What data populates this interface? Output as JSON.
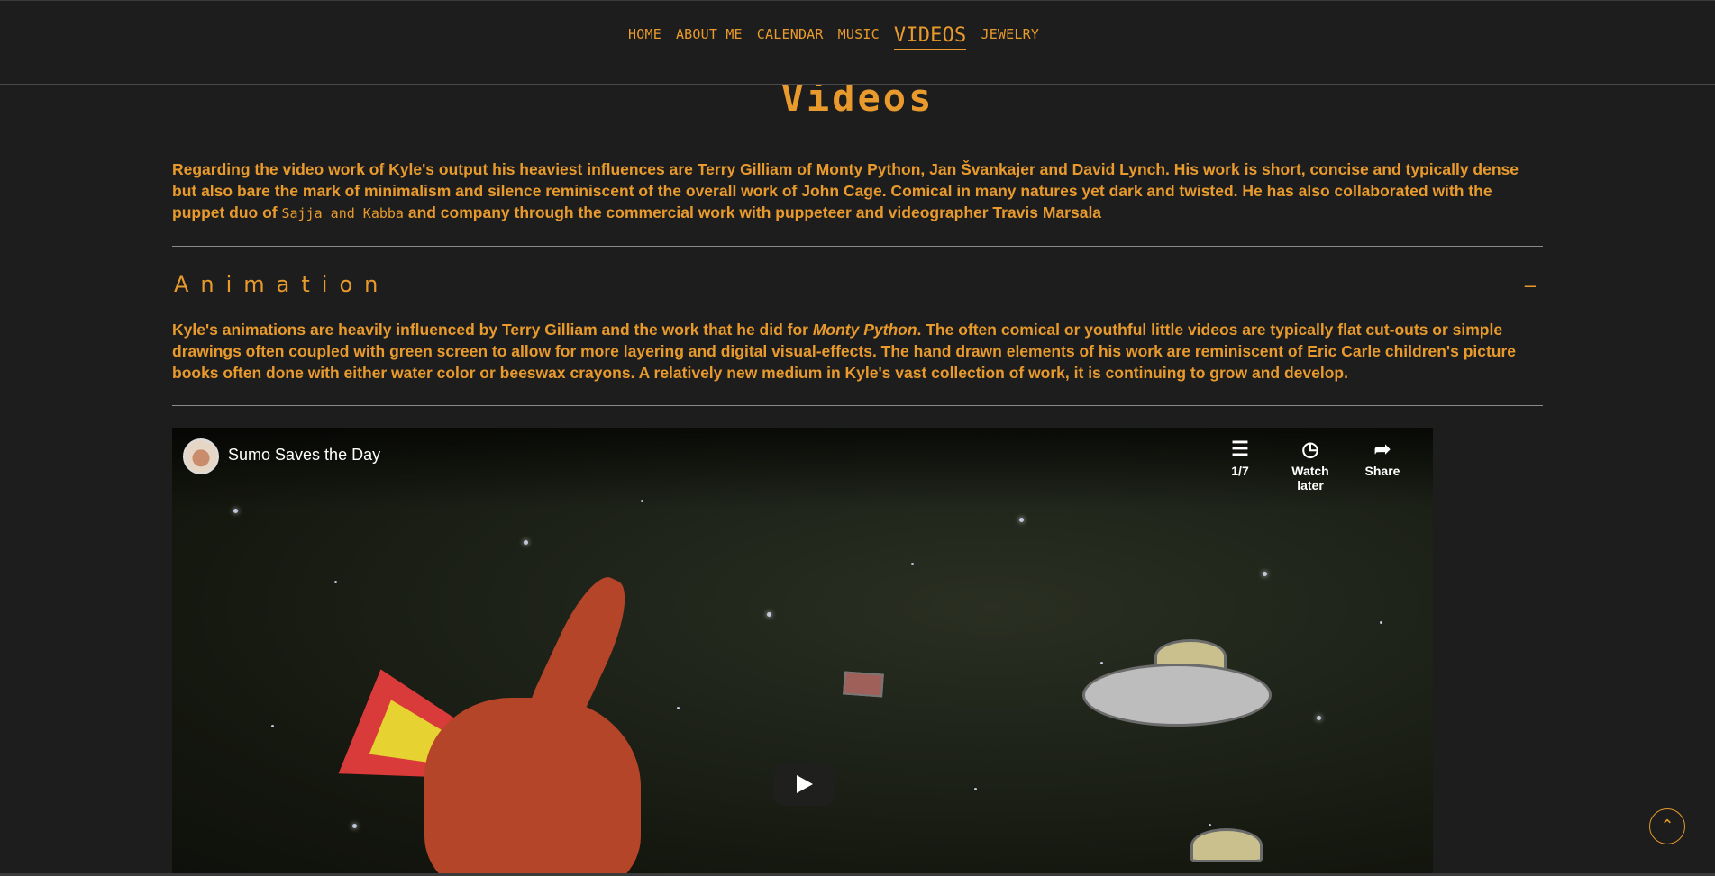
{
  "nav": {
    "items": [
      {
        "label": "HOME"
      },
      {
        "label": "ABOUT ME"
      },
      {
        "label": "CALENDAR"
      },
      {
        "label": "MUSIC"
      },
      {
        "label": "VIDEOS"
      },
      {
        "label": "JEWELRY"
      }
    ],
    "active": "VIDEOS"
  },
  "page": {
    "title": "Videos",
    "intro_1": "Regarding the video work of Kyle's output his heaviest influences are Terry Gilliam of Monty Python, Jan Švankajer and David Lynch. His work is short, concise and typically dense but also bare the mark of minimalism and silence reminiscent of the overall work of John Cage. Comical in many natures yet dark and twisted. He has also collaborated with the puppet duo of ",
    "intro_link": "Sajja and Kabba",
    "intro_2": " and company through the commercial work with puppeteer and videographer Travis Marsala"
  },
  "section": {
    "title": "Animation",
    "toggle": "–",
    "desc_1": "Kyle's animations are heavily influenced by Terry Gilliam and the work that he did for ",
    "desc_em": "Monty Python",
    "desc_2": ". The often comical or youthful little videos are typically flat cut-outs or simple drawings often coupled with green screen to allow for more layering and digital visual-effects. The hand drawn elements of his work are reminiscent of Eric Carle children's picture books often done with either water color or beeswax crayons. A relatively new medium in Kyle's vast collection of work, it is continuing to grow and develop."
  },
  "video": {
    "title": "Sumo Saves the Day",
    "playlist_label": "1/7",
    "watch_later_label": "Watch later",
    "share_label": "Share",
    "icons": {
      "playlist": "playlist-icon",
      "watch_later": "clock-icon",
      "share": "share-icon",
      "play": "play-icon"
    }
  },
  "scroll_top": {
    "icon": "chevron-up-icon",
    "glyph": "⌃"
  },
  "colors": {
    "accent": "#e89a2c",
    "background": "#1d1d1d"
  }
}
